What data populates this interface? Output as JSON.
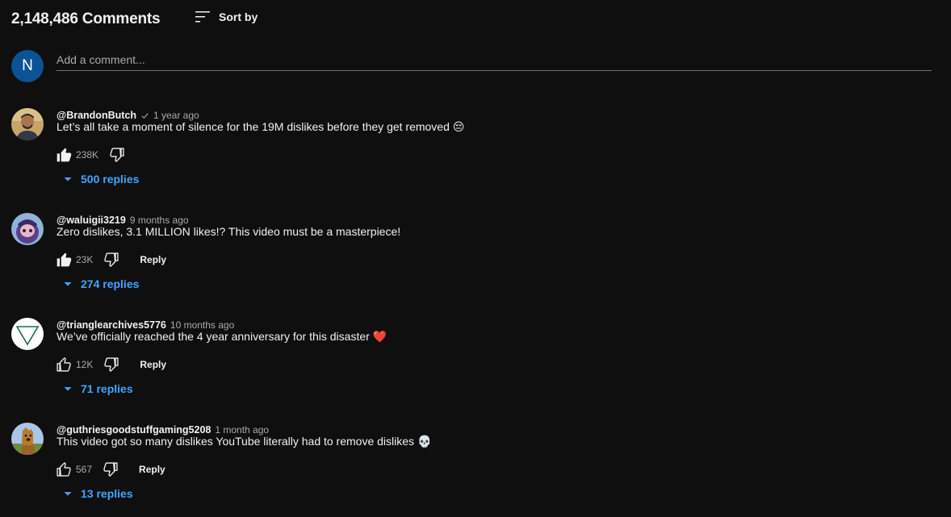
{
  "header": {
    "comment_count": "2,148,486 Comments",
    "sort_label": "Sort by"
  },
  "composer": {
    "avatar_letter": "N",
    "avatar_color": "#0b5394",
    "placeholder": "Add a comment..."
  },
  "colors": {
    "background": "#0f0f0f",
    "replies_link": "#3ea6ff",
    "muted_text": "#aaaaaa"
  },
  "comments": [
    {
      "author": "@BrandonButch",
      "verified": true,
      "time": "1 year ago",
      "text": "Let’s all take a moment of silence for the 19M dislikes before they get removed",
      "emoji": "😔",
      "likes": "238K",
      "liked": true,
      "reply_label": "",
      "replies": "500 replies"
    },
    {
      "author": "@waluigii3219",
      "verified": false,
      "time": "9 months ago",
      "text": "Zero dislikes, 3.1 MILLION likes!? This video must be a masterpiece!",
      "emoji": "",
      "likes": "23K",
      "liked": true,
      "reply_label": "Reply",
      "replies": "274 replies"
    },
    {
      "author": "@trianglearchives5776",
      "verified": false,
      "time": "10 months ago",
      "text": "We’ve officially reached the 4 year anniversary for this disaster",
      "emoji": "❤️",
      "likes": "12K",
      "liked": false,
      "reply_label": "Reply",
      "replies": "71 replies"
    },
    {
      "author": "@guthriesgoodstuffgaming5208",
      "verified": false,
      "time": "1 month ago",
      "text": "This video got so many dislikes YouTube literally had to remove dislikes",
      "emoji": "💀",
      "likes": "567",
      "liked": false,
      "reply_label": "Reply",
      "replies": "13 replies"
    }
  ]
}
